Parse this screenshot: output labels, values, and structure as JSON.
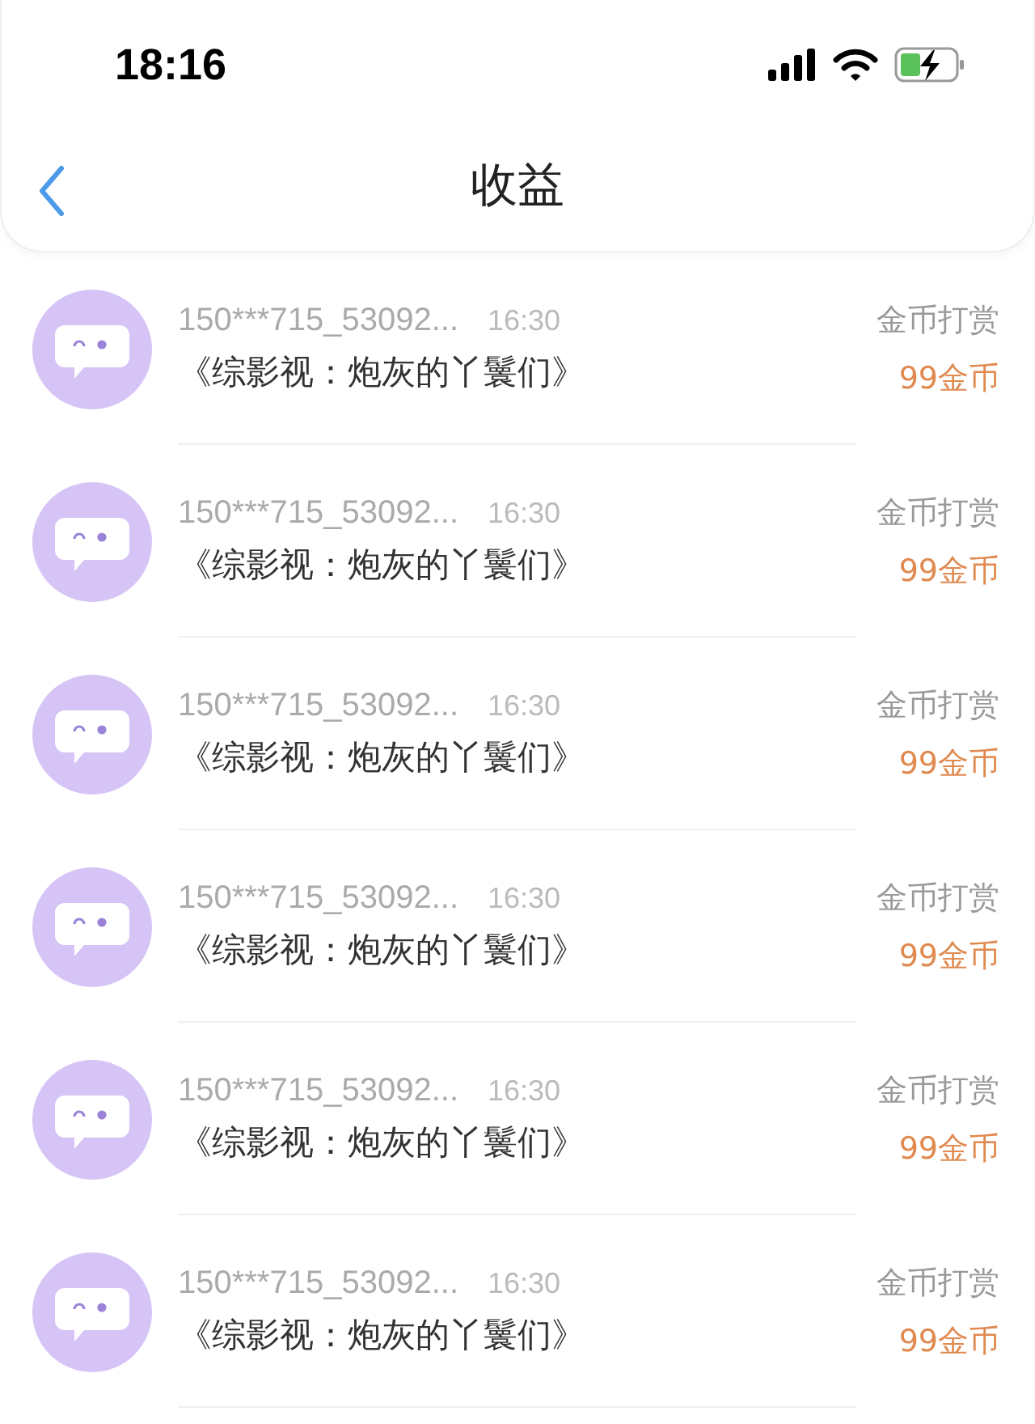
{
  "status_bar": {
    "time": "18:16"
  },
  "nav": {
    "title": "收益"
  },
  "records": [
    {
      "user": "150***715_53092...",
      "time": "16:30",
      "book": "《综影视：炮灰的丫鬟们》",
      "type": "金币打赏",
      "amount": "99金币"
    },
    {
      "user": "150***715_53092...",
      "time": "16:30",
      "book": "《综影视：炮灰的丫鬟们》",
      "type": "金币打赏",
      "amount": "99金币"
    },
    {
      "user": "150***715_53092...",
      "time": "16:30",
      "book": "《综影视：炮灰的丫鬟们》",
      "type": "金币打赏",
      "amount": "99金币"
    },
    {
      "user": "150***715_53092...",
      "time": "16:30",
      "book": "《综影视：炮灰的丫鬟们》",
      "type": "金币打赏",
      "amount": "99金币"
    },
    {
      "user": "150***715_53092...",
      "time": "16:30",
      "book": "《综影视：炮灰的丫鬟们》",
      "type": "金币打赏",
      "amount": "99金币"
    },
    {
      "user": "150***715_53092...",
      "time": "16:30",
      "book": "《综影视：炮灰的丫鬟们》",
      "type": "金币打赏",
      "amount": "99金币"
    }
  ]
}
